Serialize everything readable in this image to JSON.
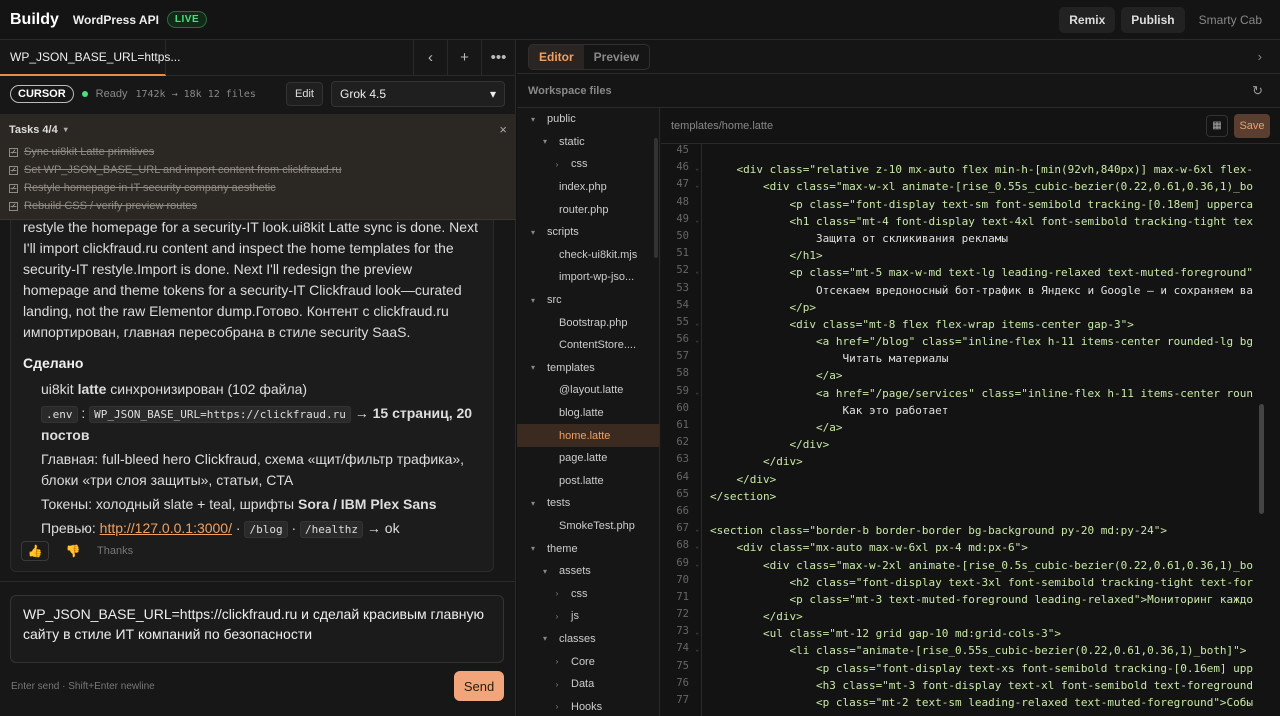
{
  "header": {
    "logo": "Buildy",
    "project": "WordPress API",
    "live_badge": "LIVE",
    "remix": "Remix",
    "publish": "Publish",
    "user": "Smarty Cab"
  },
  "left": {
    "tab_title": "WP_JSON_BASE_URL=https...",
    "icons": {
      "back": "‹",
      "plus": "+",
      "more": "•••"
    },
    "status": {
      "agent": "CURSOR",
      "ready": "Ready",
      "stats": "1742k → 18k  12 files",
      "edit": "Edit",
      "model": "Grok 4.5",
      "model_chevron": "▾"
    },
    "tasks": {
      "title": "Tasks 4/4",
      "caret": "▾",
      "close": "×",
      "items": [
        "Sync ui8kit Latte primitives",
        "Set WP_JSON_BASE_URL and import content from clickfraud.ru",
        "Restyle homepage in IT security company aesthetic",
        "Rebuild CSS / verify preview routes"
      ]
    },
    "message": {
      "paragraph": "restyle the homepage for a security-IT look.ui8kit Latte sync is done. Next I'll import clickfraud.ru content and inspect the home templates for the security-IT restyle.Import is done. Next I'll redesign the preview homepage and theme tokens for a security-IT Clickfraud look—curated landing, not the raw Elementor dump.Готово. Контент с clickfraud.ru импортирован, главная пересобрана в стиле security SaaS.",
      "done_heading": "Сделано",
      "item1_pre": "ui8kit ",
      "item1_bold": "latte",
      "item1_post": " синхронизирован (102 файла)",
      "item2_code1": ".env",
      "item2_colon": " : ",
      "item2_code2": "WP_JSON_BASE_URL=https://clickfraud.ru",
      "item2_bold": " → 15 страниц, 20 постов",
      "item3": "Главная: full-bleed hero Clickfraud, схема «щит/фильтр трафика», блоки «три слоя защиты», статьи, CTA",
      "item4_pre": "Токены: холодный slate + teal, шрифты ",
      "item4_bold": "Sora / IBM Plex Sans",
      "item5_pre": "Превью: ",
      "item5_link": "http://127.0.0.1:3000/",
      "item5_sep": " · ",
      "item5_code1": "/blog",
      "item5_sep2": " · ",
      "item5_code2": "/healthz",
      "item5_post": " → ok",
      "thanks": "Thanks"
    },
    "input_value": "WP_JSON_BASE_URL=https://clickfraud.ru и сделай красивым главную сайту в стиле ИТ компаний по безопасности",
    "hint": "Enter send · Shift+Enter newline",
    "send": "Send"
  },
  "right": {
    "tab_editor": "Editor",
    "tab_preview": "Preview",
    "workspace_title": "Workspace files",
    "file_path": "templates/home.latte",
    "save": "Save",
    "tree": [
      {
        "label": "public",
        "depth": 0,
        "toggle": "▾"
      },
      {
        "label": "static",
        "depth": 1,
        "toggle": "▾"
      },
      {
        "label": "css",
        "depth": 2,
        "toggle": "›"
      },
      {
        "label": "index.php",
        "depth": 1,
        "toggle": ""
      },
      {
        "label": "router.php",
        "depth": 1,
        "toggle": ""
      },
      {
        "label": "scripts",
        "depth": 0,
        "toggle": "▾"
      },
      {
        "label": "check-ui8kit.mjs",
        "depth": 1,
        "toggle": ""
      },
      {
        "label": "import-wp-jso...",
        "depth": 1,
        "toggle": ""
      },
      {
        "label": "src",
        "depth": 0,
        "toggle": "▾"
      },
      {
        "label": "Bootstrap.php",
        "depth": 1,
        "toggle": ""
      },
      {
        "label": "ContentStore....",
        "depth": 1,
        "toggle": ""
      },
      {
        "label": "templates",
        "depth": 0,
        "toggle": "▾"
      },
      {
        "label": "@layout.latte",
        "depth": 1,
        "toggle": ""
      },
      {
        "label": "blog.latte",
        "depth": 1,
        "toggle": ""
      },
      {
        "label": "home.latte",
        "depth": 1,
        "toggle": "",
        "selected": true
      },
      {
        "label": "page.latte",
        "depth": 1,
        "toggle": ""
      },
      {
        "label": "post.latte",
        "depth": 1,
        "toggle": ""
      },
      {
        "label": "tests",
        "depth": 0,
        "toggle": "▾"
      },
      {
        "label": "SmokeTest.php",
        "depth": 1,
        "toggle": ""
      },
      {
        "label": "theme",
        "depth": 0,
        "toggle": "▾"
      },
      {
        "label": "assets",
        "depth": 1,
        "toggle": "▾"
      },
      {
        "label": "css",
        "depth": 2,
        "toggle": "›"
      },
      {
        "label": "js",
        "depth": 2,
        "toggle": "›"
      },
      {
        "label": "classes",
        "depth": 1,
        "toggle": "▾"
      },
      {
        "label": "Core",
        "depth": 2,
        "toggle": "›"
      },
      {
        "label": "Data",
        "depth": 2,
        "toggle": "›"
      },
      {
        "label": "Hooks",
        "depth": 2,
        "toggle": "›"
      }
    ],
    "code_lines": [
      {
        "n": "45",
        "t": "",
        "fold": false
      },
      {
        "n": "46",
        "t": "    <div class=\"relative z-10 mx-auto flex min-h-[min(92vh,840px)] max-w-6xl flex-",
        "fold": true
      },
      {
        "n": "47",
        "t": "        <div class=\"max-w-xl animate-[rise_0.55s_cubic-bezier(0.22,0.61,0.36,1)_bo",
        "fold": true
      },
      {
        "n": "48",
        "t": "            <p class=\"font-display text-sm font-semibold tracking-[0.18em] upperca",
        "fold": false
      },
      {
        "n": "49",
        "t": "            <h1 class=\"mt-4 font-display text-4xl font-semibold tracking-tight tex",
        "fold": true
      },
      {
        "n": "50",
        "t": "                Защита от скликивания рекламы",
        "fold": false,
        "txt": true
      },
      {
        "n": "51",
        "t": "            </h1>",
        "fold": false
      },
      {
        "n": "52",
        "t": "            <p class=\"mt-5 max-w-md text-lg leading-relaxed text-muted-foreground\"",
        "fold": true
      },
      {
        "n": "53",
        "t": "                Отсекаем вредоносный бот-трафик в Яндекс и Google — и сохраняем ва",
        "fold": false,
        "txt": true
      },
      {
        "n": "54",
        "t": "            </p>",
        "fold": false
      },
      {
        "n": "55",
        "t": "            <div class=\"mt-8 flex flex-wrap items-center gap-3\">",
        "fold": true
      },
      {
        "n": "56",
        "t": "                <a href=\"/blog\" class=\"inline-flex h-11 items-center rounded-lg bg",
        "fold": true
      },
      {
        "n": "57",
        "t": "                    Читать материалы",
        "fold": false,
        "txt": true
      },
      {
        "n": "58",
        "t": "                </a>",
        "fold": false
      },
      {
        "n": "59",
        "t": "                <a href=\"/page/services\" class=\"inline-flex h-11 items-center roun",
        "fold": true
      },
      {
        "n": "60",
        "t": "                    Как это работает",
        "fold": false,
        "txt": true
      },
      {
        "n": "61",
        "t": "                </a>",
        "fold": false
      },
      {
        "n": "62",
        "t": "            </div>",
        "fold": false
      },
      {
        "n": "63",
        "t": "        </div>",
        "fold": false
      },
      {
        "n": "64",
        "t": "    </div>",
        "fold": false
      },
      {
        "n": "65",
        "t": "</section>",
        "fold": false
      },
      {
        "n": "66",
        "t": "",
        "fold": false
      },
      {
        "n": "67",
        "t": "<section class=\"border-b border-border bg-background py-20 md:py-24\">",
        "fold": true
      },
      {
        "n": "68",
        "t": "    <div class=\"mx-auto max-w-6xl px-4 md:px-6\">",
        "fold": true
      },
      {
        "n": "69",
        "t": "        <div class=\"max-w-2xl animate-[rise_0.5s_cubic-bezier(0.22,0.61,0.36,1)_bo",
        "fold": true
      },
      {
        "n": "70",
        "t": "            <h2 class=\"font-display text-3xl font-semibold tracking-tight text-for",
        "fold": false
      },
      {
        "n": "71",
        "t": "            <p class=\"mt-3 text-muted-foreground leading-relaxed\">Мониторинг каждо",
        "fold": false
      },
      {
        "n": "72",
        "t": "        </div>",
        "fold": false
      },
      {
        "n": "73",
        "t": "        <ul class=\"mt-12 grid gap-10 md:grid-cols-3\">",
        "fold": true
      },
      {
        "n": "74",
        "t": "            <li class=\"animate-[rise_0.55s_cubic-bezier(0.22,0.61,0.36,1)_both]\">",
        "fold": true
      },
      {
        "n": "75",
        "t": "                <p class=\"font-display text-xs font-semibold tracking-[0.16em] upp",
        "fold": false
      },
      {
        "n": "76",
        "t": "                <h3 class=\"mt-3 font-display text-xl font-semibold text-foreground",
        "fold": false
      },
      {
        "n": "77",
        "t": "                <p class=\"mt-2 text-sm leading-relaxed text-muted-foreground\">Собы",
        "fold": false
      }
    ]
  }
}
